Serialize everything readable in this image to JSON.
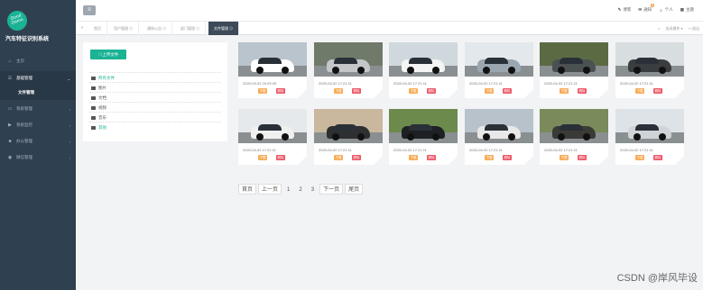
{
  "app": {
    "logo_text": "Good Demo",
    "title": "汽车特征识别系统"
  },
  "sidebar": {
    "items": [
      {
        "label": "主页",
        "icon": "home-icon"
      },
      {
        "label": "基础管理",
        "icon": "list-icon"
      },
      {
        "label": "文件管理",
        "icon": ""
      },
      {
        "label": "系统管理",
        "icon": "monitor-icon"
      },
      {
        "label": "系统监控",
        "icon": "video-icon"
      },
      {
        "label": "办公管理",
        "icon": "briefcase-icon"
      },
      {
        "label": "微信管理",
        "icon": "chat-icon"
      }
    ]
  },
  "topbar": {
    "menu_icon": "≡",
    "links": [
      {
        "icon": "edit-icon",
        "label": "博客"
      },
      {
        "icon": "mail-icon",
        "label": "通知",
        "badge": "0"
      },
      {
        "icon": "user-icon",
        "label": "个人"
      },
      {
        "icon": "th-icon",
        "label": "主题"
      }
    ]
  },
  "tabs": [
    {
      "label": "首页"
    },
    {
      "label": "用户管理 ⊙"
    },
    {
      "label": "通知公告 ⊙"
    },
    {
      "label": "部门管理 ⊙"
    },
    {
      "label": "文件管理 ⊙"
    }
  ],
  "tab_ops": {
    "forward": "»",
    "back": "«",
    "actions": "关闭操作 ▾",
    "exit": "↪ 退出"
  },
  "file_panel": {
    "upload_label": "☁上传文件",
    "folders": [
      "所有文件",
      "图片",
      "文档",
      "视频",
      "音乐",
      "其他"
    ]
  },
  "cards": {
    "download_label": "下载",
    "delete_label": "删除",
    "items": [
      {
        "timestamp": "2020-04-02 16:29:49",
        "car_color": "#ffffff",
        "bg": "#b9c4cc"
      },
      {
        "timestamp": "2020-04-02 17:21:11",
        "car_color": "#c4c6c8",
        "bg": "#6f7a6a"
      },
      {
        "timestamp": "2020-04-02 17:21:11",
        "car_color": "#f4f4f4",
        "bg": "#cfd8dc"
      },
      {
        "timestamp": "2020-04-02 17:21:11",
        "car_color": "#9aa7b1",
        "bg": "#e3e8ec"
      },
      {
        "timestamp": "2020-04-02 17:21:11",
        "car_color": "#4b5053",
        "bg": "#5a6b44"
      },
      {
        "timestamp": "2020-04-02 17:21:11",
        "car_color": "#3a3d40",
        "bg": "#d8dde0"
      },
      {
        "timestamp": "2020-04-02 17:21:11",
        "car_color": "#f0f0f0",
        "bg": "#e6e9eb"
      },
      {
        "timestamp": "2020-04-02 17:21:11",
        "car_color": "#2e2f30",
        "bg": "#c9b89e"
      },
      {
        "timestamp": "2020-04-02 17:21:11",
        "car_color": "#1e2124",
        "bg": "#6b8a4c"
      },
      {
        "timestamp": "2020-04-02 17:21:11",
        "car_color": "#e8e8e8",
        "bg": "#b7c2ca"
      },
      {
        "timestamp": "2020-04-02 17:21:11",
        "car_color": "#3a3b36",
        "bg": "#7a8a5a"
      },
      {
        "timestamp": "2020-04-02 17:21:11",
        "car_color": "#cfd4d8",
        "bg": "#dde3e7"
      }
    ]
  },
  "pagination": {
    "first": "首页",
    "prev": "上一页",
    "pages": [
      "1",
      "2",
      "3"
    ],
    "current": "1",
    "next": "下一页",
    "last": "尾页"
  },
  "watermark": "CSDN @岸风毕设"
}
